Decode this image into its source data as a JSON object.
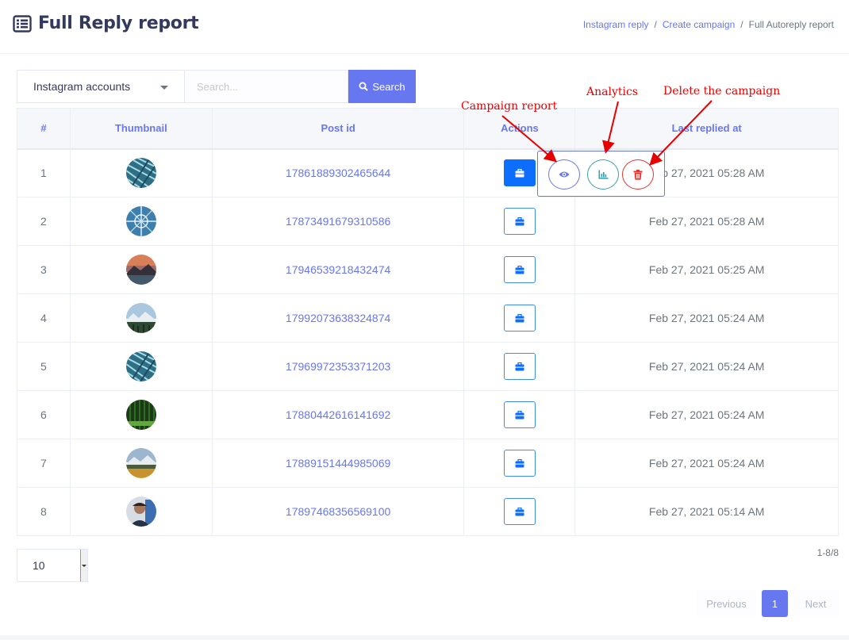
{
  "header": {
    "title": "Full Reply report",
    "breadcrumb": [
      "Instagram reply",
      "Create campaign",
      "Full Autoreply report"
    ]
  },
  "filters": {
    "account_select": "Instagram accounts",
    "search_placeholder": "Search...",
    "search_label": "Search"
  },
  "table": {
    "columns": [
      "#",
      "Thumbnail",
      "Post id",
      "Actions",
      "Last replied at"
    ],
    "rows": [
      {
        "num": "1",
        "post_id": "17861889302465644",
        "date": "Feb 27, 2021 05:28 AM",
        "thumb": "blue-ice"
      },
      {
        "num": "2",
        "post_id": "17873491679310586",
        "date": "Feb 27, 2021 05:28 AM",
        "thumb": "blue-pattern"
      },
      {
        "num": "3",
        "post_id": "17946539218432474",
        "date": "Feb 27, 2021 05:25 AM",
        "thumb": "sunset-lake"
      },
      {
        "num": "4",
        "post_id": "17992073638324874",
        "date": "Feb 27, 2021 05:24 AM",
        "thumb": "snow-mountains"
      },
      {
        "num": "5",
        "post_id": "17969972353371203",
        "date": "Feb 27, 2021 05:24 AM",
        "thumb": "blue-ice"
      },
      {
        "num": "6",
        "post_id": "17880442616141692",
        "date": "Feb 27, 2021 05:24 AM",
        "thumb": "green-forest"
      },
      {
        "num": "7",
        "post_id": "17889151444985069",
        "date": "Feb 27, 2021 05:24 AM",
        "thumb": "mountain-field"
      },
      {
        "num": "8",
        "post_id": "17897468356569100",
        "date": "Feb 27, 2021 05:14 AM",
        "thumb": "portrait"
      }
    ]
  },
  "popover": {
    "buttons": [
      "eye-icon",
      "bar-chart-icon",
      "trash-icon"
    ]
  },
  "annotations": {
    "campaign_report": "Campaign report",
    "analytics": "Analytics",
    "delete": "Delete the campaign"
  },
  "pagination": {
    "per_page": "10",
    "count": "1-8/8",
    "previous": "Previous",
    "current": "1",
    "next": "Next"
  },
  "colors": {
    "primary": "#6777ef",
    "active_button": "#0d6efd",
    "annotation": "#e60000",
    "danger": "#e3342f",
    "info": "#3ba3b0"
  }
}
